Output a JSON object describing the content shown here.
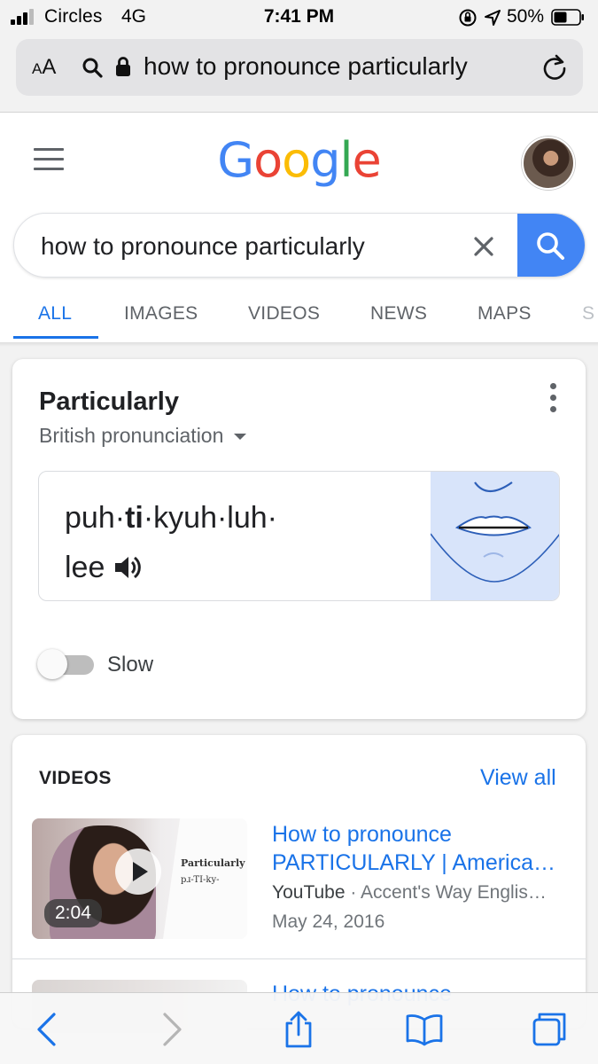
{
  "status": {
    "carrier": "Circles",
    "network": "4G",
    "time": "7:41 PM",
    "battery": "50%"
  },
  "browser": {
    "text_size_label": "AA",
    "url": "how to pronounce particularly"
  },
  "google": {
    "logo": "Google",
    "query": "how to pronounce particularly",
    "tabs": [
      "ALL",
      "IMAGES",
      "VIDEOS",
      "NEWS",
      "MAPS",
      "S"
    ]
  },
  "pronunciation": {
    "word": "Particularly",
    "accent": "British pronunciation",
    "syllables_line1_pre": "puh·",
    "syllables_line1_bold": "ti",
    "syllables_line1_post": "·kyuh·luh·",
    "syllables_line2": "lee",
    "slow_label": "Slow"
  },
  "videos": {
    "header": "VIDEOS",
    "view_all": "View all",
    "items": [
      {
        "title_line1": "How to pronounce",
        "title_line2": "PARTICULARLY | America…",
        "platform": "YouTube",
        "channel": "· Accent's Way Englis…",
        "date": "May 24, 2016",
        "duration": "2:04",
        "thumb_title": "Particularly",
        "thumb_sub": "pɹ-TI-ky-"
      },
      {
        "title_line1": "How to pronounce"
      }
    ]
  },
  "icons": [
    "signal-icon",
    "rotation-lock-icon",
    "location-icon",
    "battery-icon",
    "search-icon",
    "lock-icon",
    "reload-icon",
    "menu-icon",
    "clear-icon",
    "more-icon",
    "speaker-icon",
    "play-icon",
    "back-icon",
    "forward-icon",
    "share-icon",
    "bookmarks-icon",
    "tabs-icon"
  ],
  "colors": {
    "accent": "#1a73e8",
    "search_button": "#4285f4",
    "mouth_bg": "#d8e4fa"
  }
}
